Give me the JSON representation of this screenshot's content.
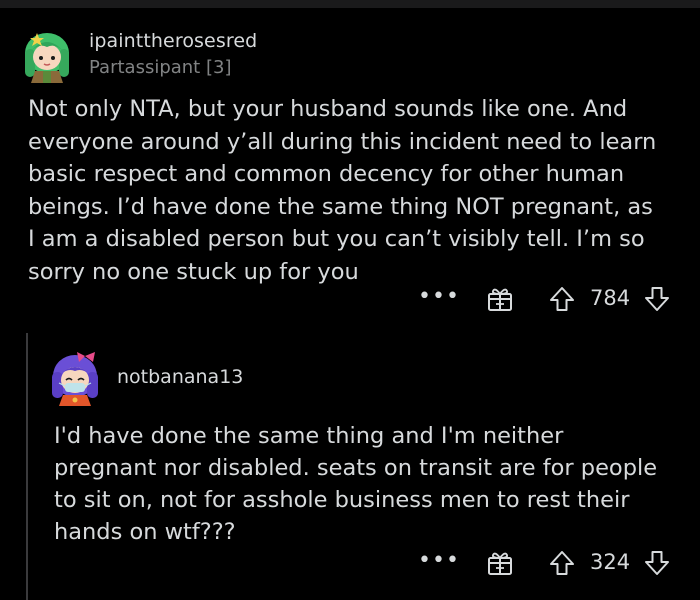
{
  "comments": [
    {
      "username": "ipainttherosesred",
      "flair": "Partassipant [3]",
      "body_lines": [
        "Not only NTA, but your husband sounds like one.  And",
        "everyone around y’all during this incident need to learn",
        "basic respect and common decency for other human",
        "beings. I’d have done the same thing NOT pregnant, as",
        "I am a disabled person but you can’t visibly tell. I’m so",
        "sorry no one stuck up for you"
      ],
      "more_label": "•••",
      "score": "784"
    },
    {
      "username": "notbanana13",
      "body_lines": [
        "I'd have done the same thing and I'm neither",
        "pregnant nor disabled. seats on transit are for people",
        "to sit on, not for asshole business men to rest their",
        "hands on wtf???"
      ],
      "more_label": "•••",
      "score": "324"
    }
  ],
  "icons": {
    "avatar1": "avatar-icon",
    "avatar2": "avatar-icon",
    "more": "more-options-icon",
    "gift": "award-gift-icon",
    "upvote": "upvote-arrow-icon",
    "downvote": "downvote-arrow-icon"
  },
  "colors": {
    "background": "#000000",
    "text": "#d7dadc",
    "muted": "#818384",
    "thread_line": "#3a3a3c"
  }
}
